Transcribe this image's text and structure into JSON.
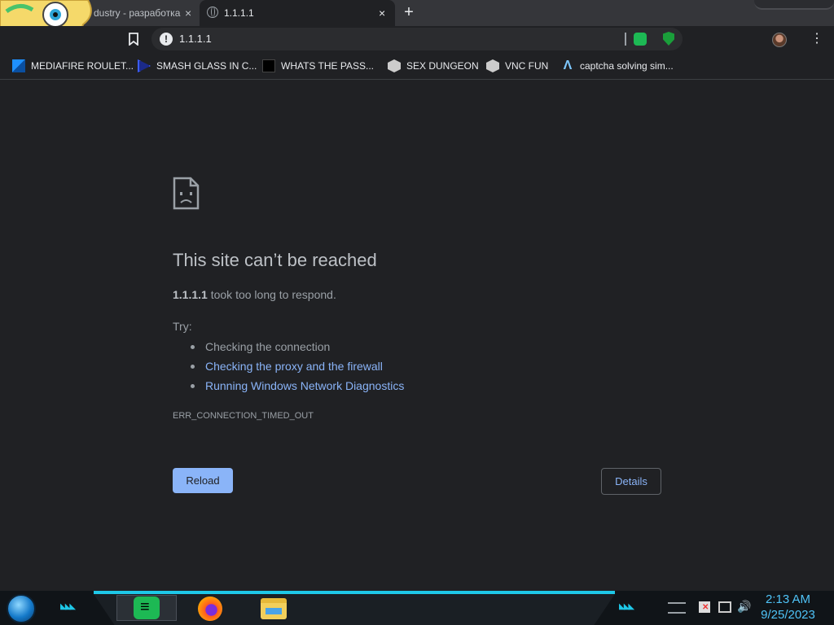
{
  "tabs": [
    {
      "title": "dustry - разработка",
      "close": "×"
    },
    {
      "title": "1.1.1.1",
      "close": "×"
    }
  ],
  "new_tab_label": "+",
  "toolbar": {
    "info_glyph": "!",
    "url": "1.1.1.1",
    "menu_glyph": "⋮"
  },
  "bookmarks": [
    {
      "label": "MEDIAFIRE ROULET...",
      "icon": "mediafire-icon"
    },
    {
      "label": "SMASH GLASS IN C...",
      "icon": "vscode-icon"
    },
    {
      "label": "WHATS THE PASS...",
      "icon": "robot-icon"
    },
    {
      "label": "SEX DUNGEON",
      "icon": "hex-icon"
    },
    {
      "label": "VNC FUN",
      "icon": "hex-icon"
    },
    {
      "label": "captcha solving sim...",
      "icon": "lambda-icon"
    }
  ],
  "error_page": {
    "title": "This site can’t be reached",
    "host": "1.1.1.1",
    "message": " took too long to respond.",
    "try_label": "Try:",
    "suggestions": [
      "Checking the connection",
      "Checking the proxy and the firewall",
      "Running Windows Network Diagnostics"
    ],
    "error_code": "ERR_CONNECTION_TIMED_OUT",
    "reload_label": "Reload",
    "details_label": "Details"
  },
  "taskbar": {
    "apps": [
      "spotify-icon",
      "firefox-icon",
      "file-explorer-icon"
    ],
    "clock_time": "2:13 AM",
    "clock_date": "9/25/2023",
    "chevrons": "◣◣◣"
  },
  "colors": {
    "page_bg": "#202124",
    "link": "#8ab4f8",
    "accent_cyan": "#1ec8e8",
    "clock": "#4fc3f7"
  }
}
